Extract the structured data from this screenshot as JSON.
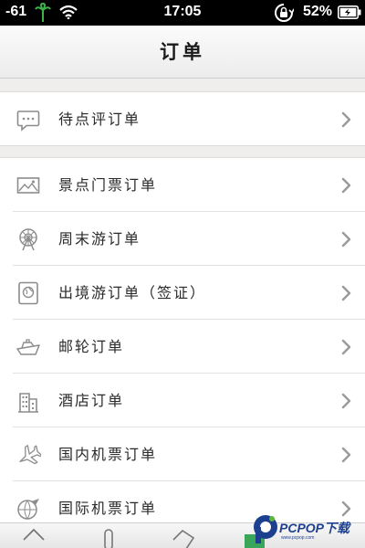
{
  "status_bar": {
    "signal": "-61",
    "time": "17:05",
    "battery": "52%",
    "icons": [
      "palm-tree-icon",
      "wifi-icon",
      "rotation-lock-icon",
      "battery-charging-icon"
    ]
  },
  "header": {
    "title": "订单"
  },
  "groups": [
    {
      "items": [
        {
          "label": "待点评订单",
          "icon": "comment-icon"
        }
      ]
    },
    {
      "items": [
        {
          "label": "景点门票订单",
          "icon": "ticket-landscape-icon"
        },
        {
          "label": "周末游订单",
          "icon": "ferris-wheel-icon"
        },
        {
          "label": "出境游订单（签证）",
          "icon": "passport-globe-icon"
        },
        {
          "label": "邮轮订单",
          "icon": "cruise-ship-icon"
        },
        {
          "label": "酒店订单",
          "icon": "hotel-building-icon"
        },
        {
          "label": "国内机票订单",
          "icon": "airplane-icon"
        },
        {
          "label": "国际机票订单",
          "icon": "globe-plane-icon"
        }
      ]
    }
  ],
  "tab_bar": {
    "icons": [
      "home-icon",
      "microphone-icon",
      "ticket-icon",
      "orders-icon",
      "user-icon"
    ]
  },
  "watermark": {
    "brand": "PCPOP下载",
    "sub": "www.pcpop.com",
    "colors": {
      "primary": "#1d3f8f",
      "accent": "#5fb43a"
    }
  },
  "colors": {
    "background": "#efeeec",
    "row_bg": "#ffffff",
    "chevron": "#9a9a9a",
    "icon": "#8c8c8c"
  }
}
